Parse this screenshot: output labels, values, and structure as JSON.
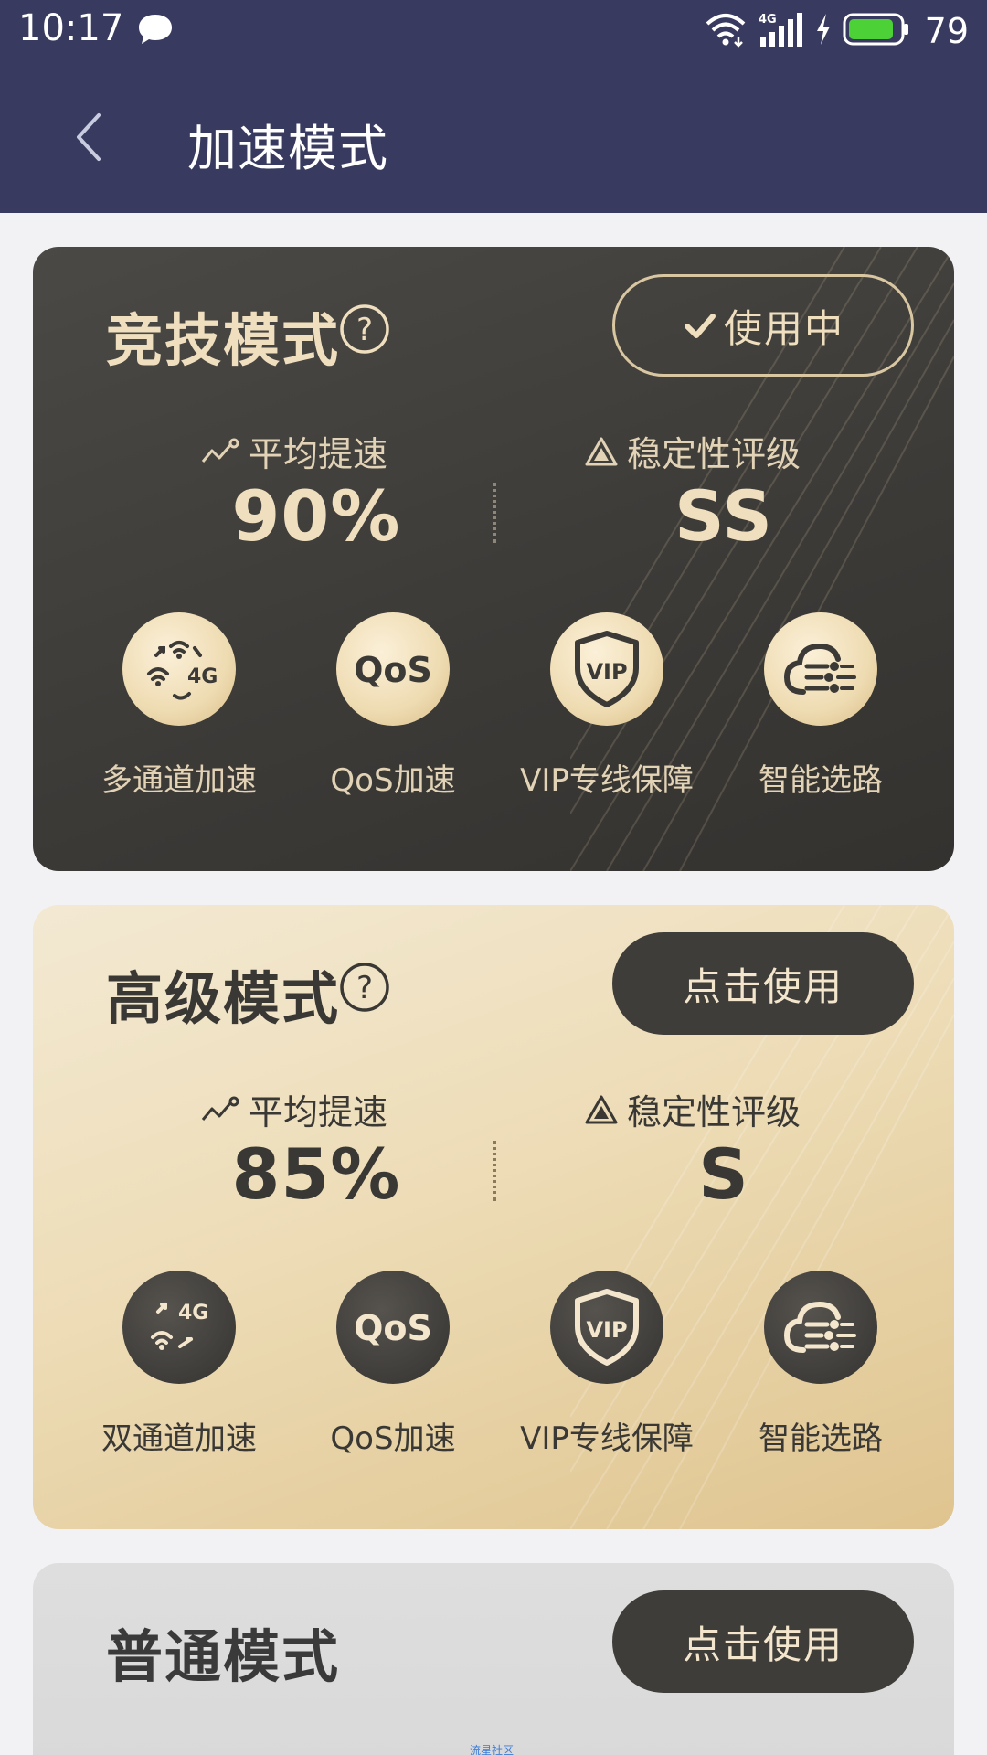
{
  "status_bar": {
    "time": "10:17",
    "battery": "79"
  },
  "header": {
    "title": "加速模式"
  },
  "cards": [
    {
      "title": "竞技模式",
      "button_label": "使用中",
      "avg_speed_label": "平均提速",
      "avg_speed_value": "90%",
      "stability_label": "稳定性评级",
      "stability_value": "SS",
      "features": [
        "多通道加速",
        "QoS加速",
        "VIP专线保障",
        "智能选路"
      ]
    },
    {
      "title": "高级模式",
      "button_label": "点击使用",
      "avg_speed_label": "平均提速",
      "avg_speed_value": "85%",
      "stability_label": "稳定性评级",
      "stability_value": "S",
      "features": [
        "双通道加速",
        "QoS加速",
        "VIP专线保障",
        "智能选路"
      ]
    },
    {
      "title": "普通模式",
      "button_label": "点击使用"
    }
  ],
  "watermark": "流星社区",
  "colors": {
    "header_bg": "#383b5f",
    "dark_card": "#3c3a37",
    "gold_card": "#eddcb6",
    "gold_accent": "#efdfbf"
  }
}
